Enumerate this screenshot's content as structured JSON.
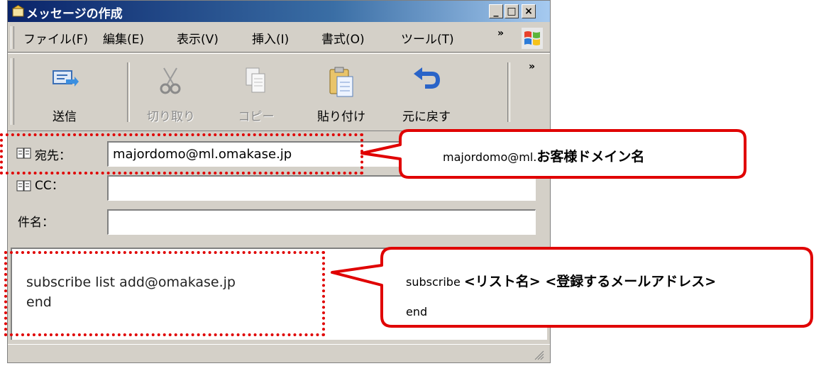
{
  "window": {
    "title": "メッセージの作成",
    "controls": {
      "minimize": "_",
      "maximize": "□",
      "close": "×"
    }
  },
  "menu": {
    "items": [
      "ファイル(F)",
      "編集(E)",
      "表示(V)",
      "挿入(I)",
      "書式(O)",
      "ツール(T)"
    ],
    "overflow": "»"
  },
  "toolbar": {
    "buttons": [
      {
        "label": "送信",
        "icon": "send-icon",
        "enabled": true
      },
      {
        "label": "切り取り",
        "icon": "scissors-icon",
        "enabled": false
      },
      {
        "label": "コピー",
        "icon": "copy-icon",
        "enabled": false
      },
      {
        "label": "貼り付け",
        "icon": "paste-icon",
        "enabled": true
      },
      {
        "label": "元に戻す",
        "icon": "undo-icon",
        "enabled": true
      }
    ],
    "overflow": "»"
  },
  "fields": {
    "to_label": "宛先：",
    "to_value": "majordomo@ml.omakase.jp",
    "cc_label": "CC：",
    "cc_value": "",
    "subject_label": "件名：",
    "subject_value": ""
  },
  "body": {
    "lines": [
      "subscribe list add@omakase.jp",
      "end"
    ]
  },
  "callouts": {
    "to": {
      "prefix": "majordomo@ml.",
      "bold": "お客様ドメイン名"
    },
    "body": {
      "line1_prefix": "subscribe ",
      "line1_bold": "<リスト名> <登録するメールアドレス>",
      "line2": "end"
    }
  },
  "colors": {
    "highlight": "#e00000",
    "titlebar": "#0a246a",
    "chrome": "#d4d0c8"
  }
}
